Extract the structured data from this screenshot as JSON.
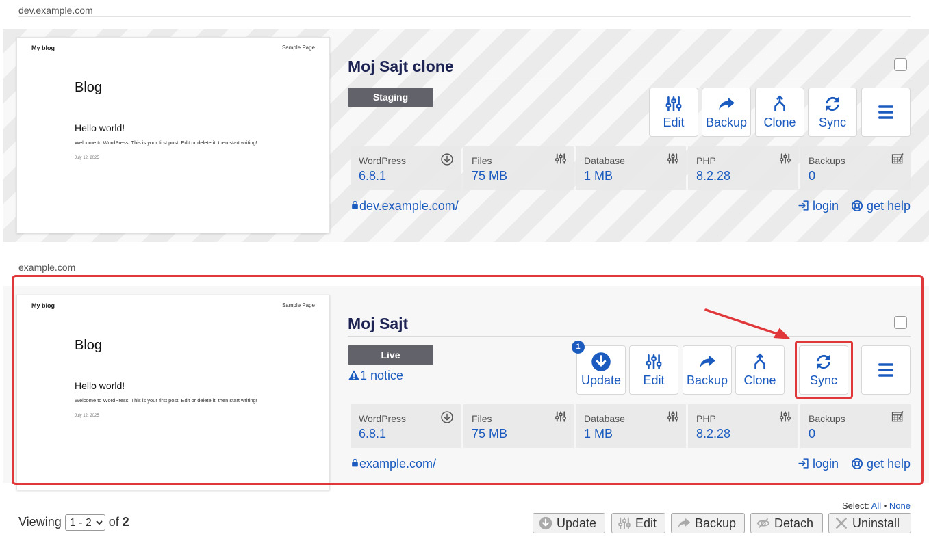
{
  "sites": [
    {
      "domain_label": "dev.example.com",
      "name": "Moj Sajt clone",
      "environment": "Staging",
      "notice": "",
      "actions": [
        "Edit",
        "Backup",
        "Clone",
        "Sync"
      ],
      "stats": [
        {
          "label": "WordPress",
          "value": "6.8.1",
          "icon": "download-circle-icon"
        },
        {
          "label": "Files",
          "value": "75 MB",
          "icon": "sliders-icon"
        },
        {
          "label": "Database",
          "value": "1 MB",
          "icon": "sliders-icon"
        },
        {
          "label": "PHP",
          "value": "8.2.28",
          "icon": "sliders-icon"
        },
        {
          "label": "Backups",
          "value": "0",
          "icon": "calendar-edit-icon"
        }
      ],
      "url": "dev.example.com/",
      "login_label": "login",
      "help_label": "get help"
    },
    {
      "domain_label": "example.com",
      "name": "Moj Sajt",
      "environment": "Live",
      "notice": "1 notice",
      "update_count": "1",
      "actions": [
        "Update",
        "Edit",
        "Backup",
        "Clone",
        "Sync"
      ],
      "stats": [
        {
          "label": "WordPress",
          "value": "6.8.1",
          "icon": "download-circle-icon"
        },
        {
          "label": "Files",
          "value": "75 MB",
          "icon": "sliders-icon"
        },
        {
          "label": "Database",
          "value": "1 MB",
          "icon": "sliders-icon"
        },
        {
          "label": "PHP",
          "value": "8.2.28",
          "icon": "sliders-icon"
        },
        {
          "label": "Backups",
          "value": "0",
          "icon": "calendar-edit-icon"
        }
      ],
      "url": "example.com/",
      "login_label": "login",
      "help_label": "get help"
    }
  ],
  "thumbnail": {
    "logo": "My blog",
    "nav": "Sample Page",
    "title": "Blog",
    "post_title": "Hello world!",
    "excerpt": "Welcome to WordPress. This is your first post. Edit or delete it, then start writing!",
    "date": "July 12, 2025"
  },
  "pagination": {
    "viewing_label": "Viewing",
    "range": "1 - 2",
    "of_label": "of",
    "total": "2"
  },
  "select_line": {
    "label": "Select:",
    "all": "All",
    "separator": "•",
    "none": "None"
  },
  "bulk_actions": [
    "Update",
    "Edit",
    "Backup",
    "Detach",
    "Uninstall"
  ],
  "colors": {
    "accent": "#1b5bbf",
    "title": "#1d2353",
    "badge": "#62626a",
    "highlight": "#e0383a"
  }
}
